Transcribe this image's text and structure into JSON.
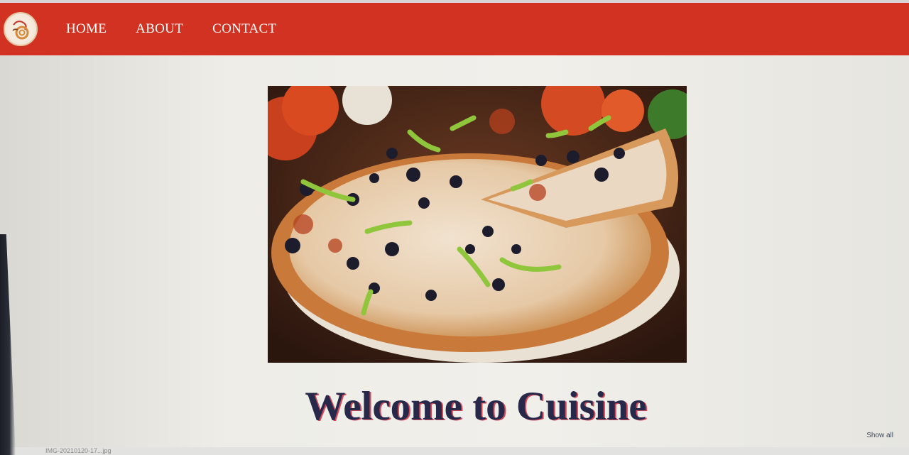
{
  "nav": {
    "links": [
      "HOME",
      "ABOUT",
      "CONTACT"
    ]
  },
  "hero": {
    "heading": "Welcome to Cuisine"
  },
  "downloads": {
    "file_name": "IMG-20210120-17...jpg",
    "show_all": "Show all"
  },
  "colors": {
    "navbar": "#d23222",
    "heading": "#27294a",
    "heading_shadow": "#d24a5a"
  },
  "icons": {
    "logo": "chef-logo-icon"
  }
}
